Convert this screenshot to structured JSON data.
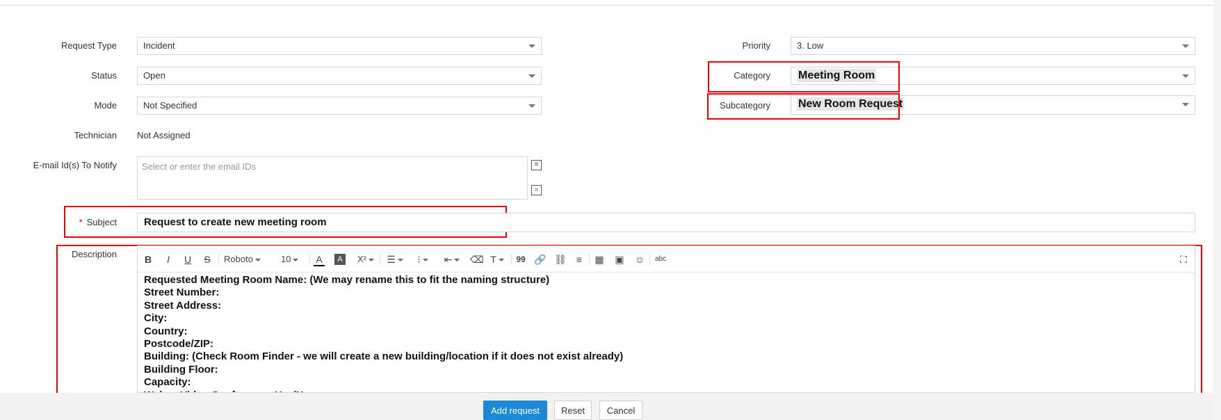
{
  "form": {
    "request_type": {
      "label": "Request Type",
      "value": "Incident"
    },
    "status": {
      "label": "Status",
      "value": "Open"
    },
    "mode": {
      "label": "Mode",
      "value": "Not Specified"
    },
    "technician": {
      "label": "Technician",
      "value": "Not Assigned"
    },
    "email": {
      "label": "E-mail Id(s) To Notify",
      "placeholder": "Select or enter the email IDs"
    },
    "priority": {
      "label": "Priority",
      "value": "3. Low"
    },
    "category": {
      "label": "Category",
      "value": "Meeting Room"
    },
    "subcategory": {
      "label": "Subcategory",
      "value": "New Room Request"
    },
    "subject": {
      "label": "Subject",
      "required_mark": "*",
      "value": "Request to create new meeting room"
    },
    "description": {
      "label": "Description",
      "font": "Roboto",
      "font_size": "10",
      "lines": [
        "Requested Meeting Room Name: (We may rename this to fit the naming structure)",
        "Street Number:",
        "Street Address:",
        "City:",
        "Country:",
        "Postcode/ZIP:",
        "Building: (Check Room Finder - we will create a new building/location if it does not exist already)",
        "Building Floor:",
        "Capacity:",
        "Webex Video Conference: Yes/No"
      ]
    }
  },
  "toolbar": {
    "bold": "B",
    "italic": "I",
    "underline": "U",
    "strike": "S",
    "text_color": "A",
    "bg_color": "A",
    "superscript": "X²",
    "quote": "99",
    "spellcheck": "abc"
  },
  "actions": {
    "add": "Add request",
    "reset": "Reset",
    "cancel": "Cancel"
  },
  "colors": {
    "primary": "#1a8ad8",
    "annotation": "#ee0000"
  }
}
